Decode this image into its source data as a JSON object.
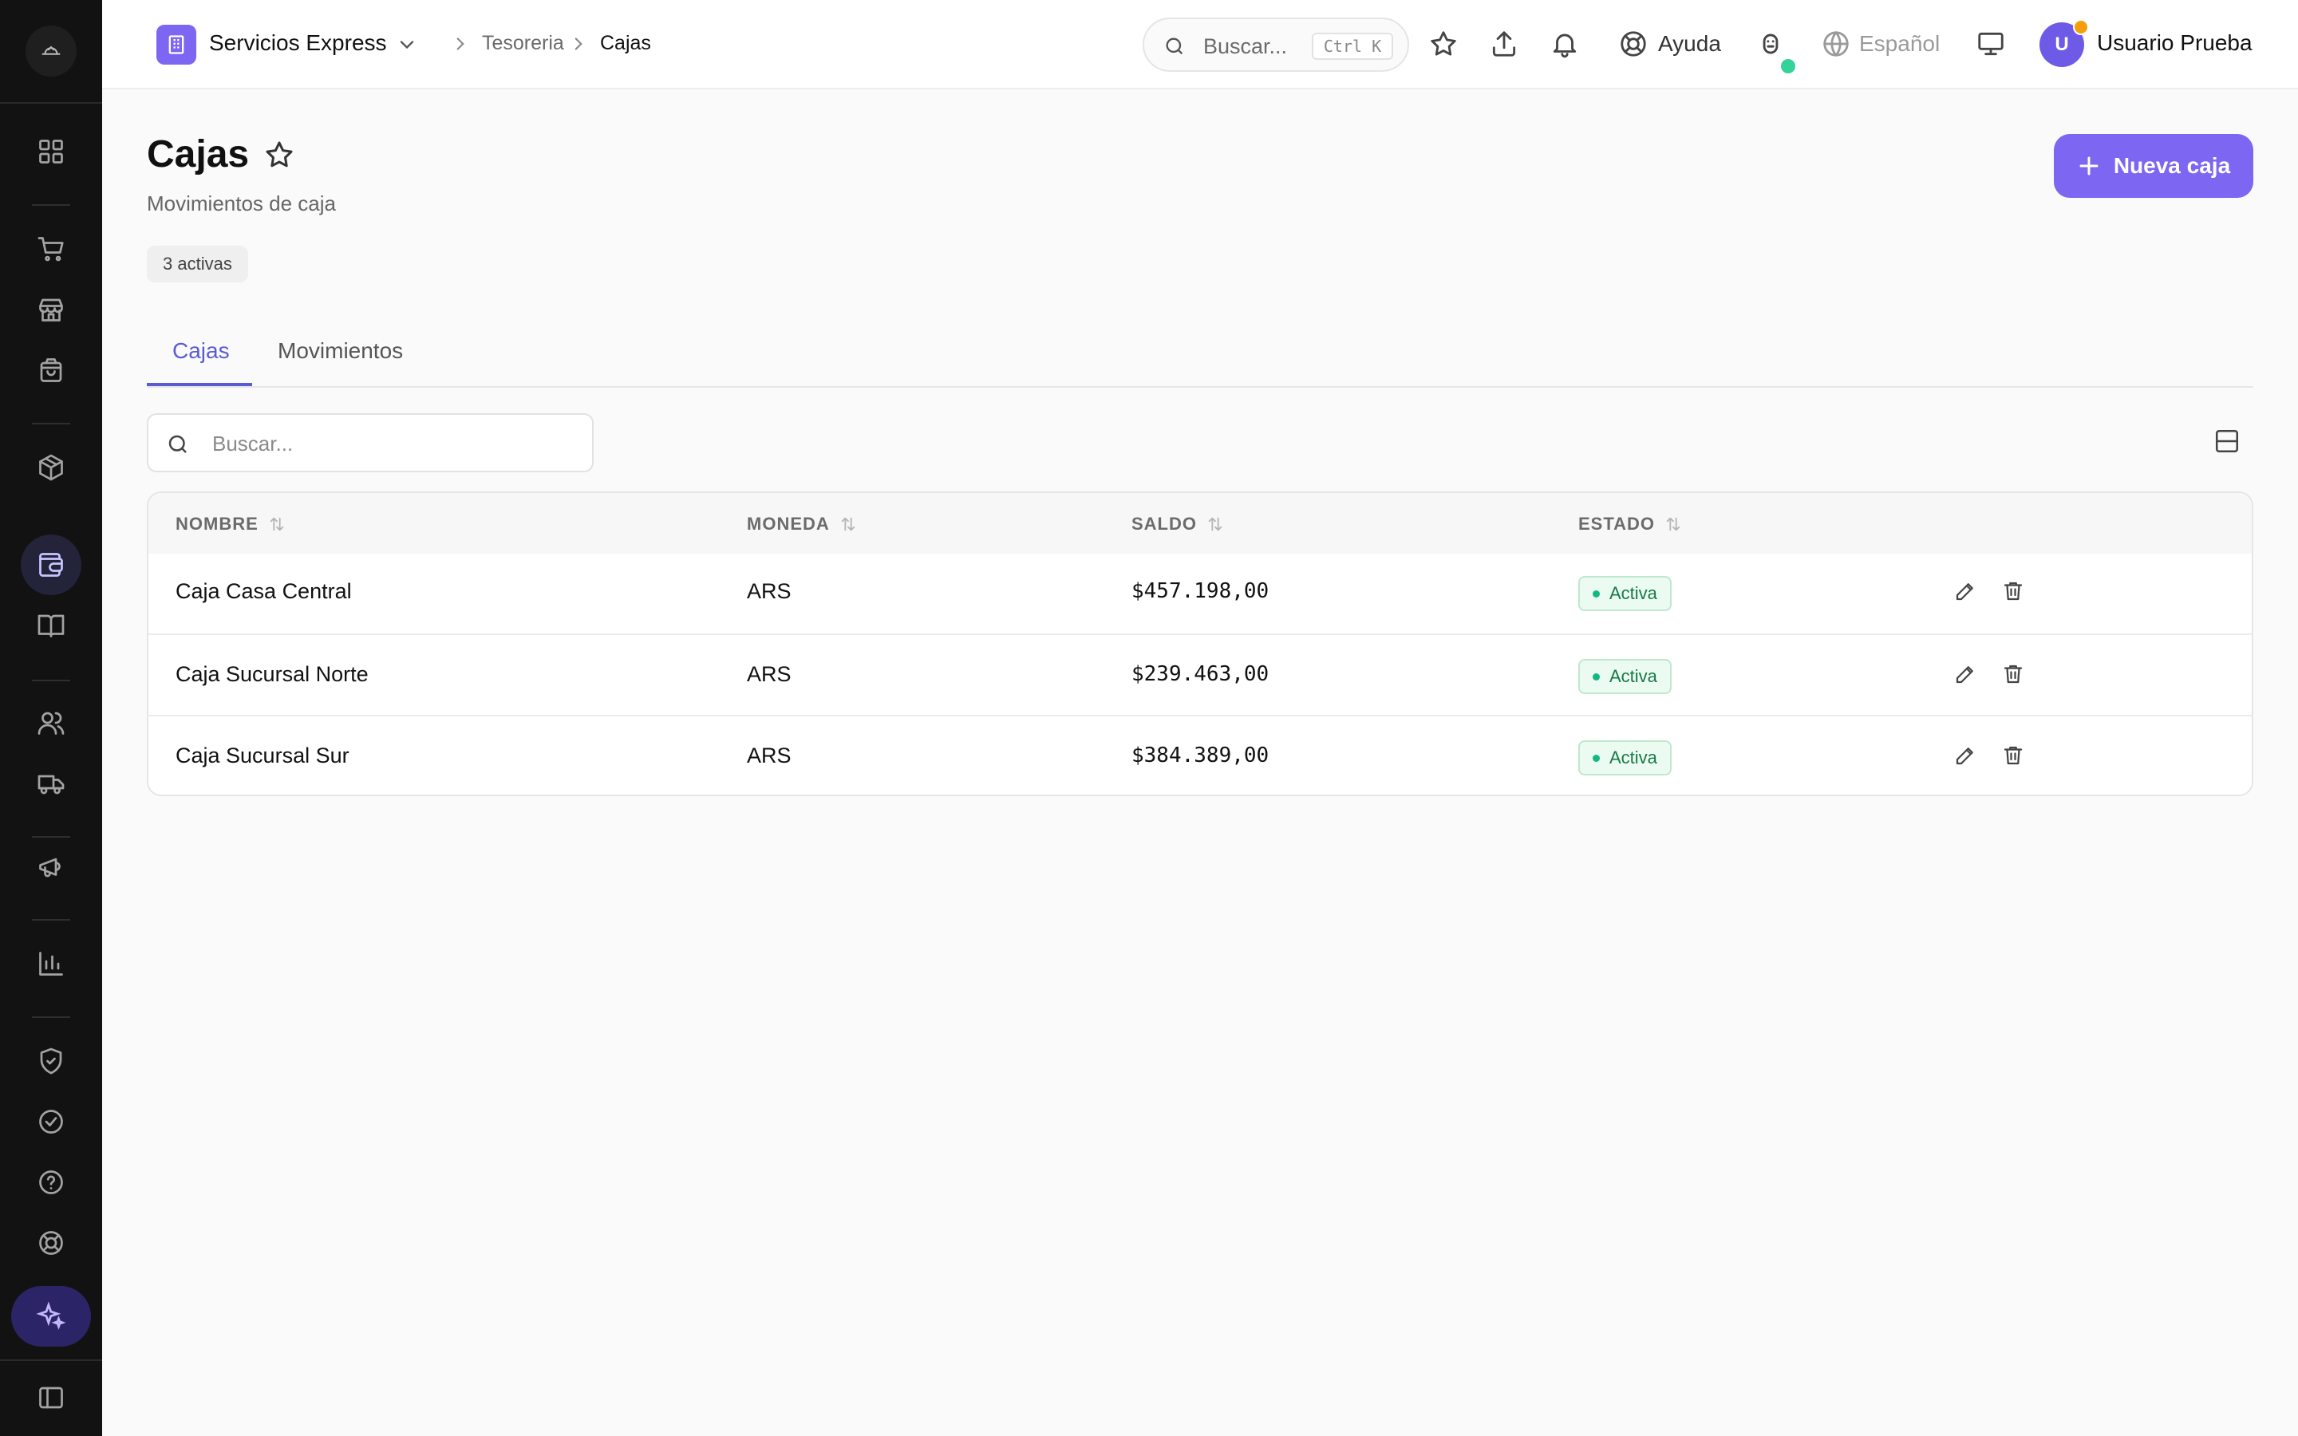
{
  "sidebar": {
    "icons": [
      "logo-icon",
      "dashboard-icon",
      "cart-icon",
      "store-icon",
      "bag-icon",
      "box-icon",
      "wallet-icon",
      "book-icon",
      "users-icon",
      "truck-icon",
      "megaphone-icon",
      "chart-icon",
      "shield-icon",
      "check-circle-icon",
      "help-icon",
      "lifebuoy-icon",
      "sparkles-icon",
      "sidebar-toggle-icon"
    ],
    "active": "wallet-icon"
  },
  "topbar": {
    "org_name": "Servicios Express",
    "breadcrumb": [
      "Tesoreria",
      "Cajas"
    ],
    "search_placeholder": "Buscar...",
    "search_shortcut": "Ctrl K",
    "help_label": "Ayuda",
    "language_label": "Español",
    "user_initial": "U",
    "user_name": "Usuario Prueba"
  },
  "header": {
    "title": "Cajas",
    "subtitle": "Movimientos de caja",
    "count_chip": "3 activas",
    "new_button": "Nueva caja"
  },
  "tabs": [
    {
      "label": "Cajas",
      "active": true
    },
    {
      "label": "Movimientos",
      "active": false
    }
  ],
  "search": {
    "placeholder": "Buscar..."
  },
  "table": {
    "columns": [
      "NOMBRE",
      "MONEDA",
      "SALDO",
      "ESTADO"
    ],
    "rows": [
      {
        "nombre": "Caja Casa Central",
        "moneda": "ARS",
        "saldo": "$457.198,00",
        "estado": "Activa"
      },
      {
        "nombre": "Caja Sucursal Norte",
        "moneda": "ARS",
        "saldo": "$239.463,00",
        "estado": "Activa"
      },
      {
        "nombre": "Caja Sucursal Sur",
        "moneda": "ARS",
        "saldo": "$384.389,00",
        "estado": "Activa"
      }
    ]
  },
  "colors": {
    "accent": "#7c66f2",
    "tab_active": "#5b5bd6",
    "status_active": "#10b981",
    "sidebar_bg": "#121212"
  }
}
